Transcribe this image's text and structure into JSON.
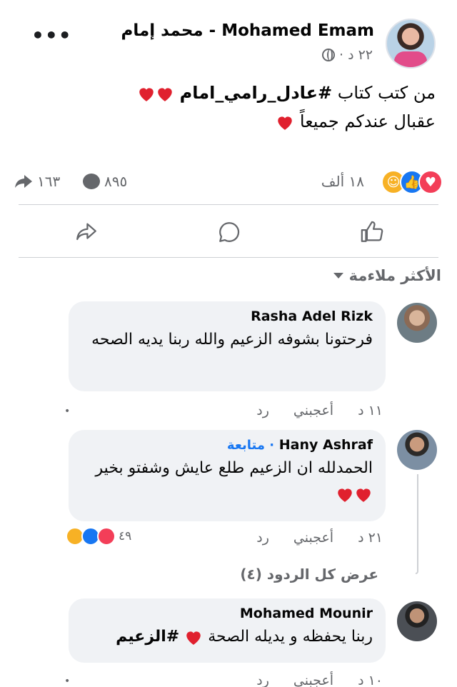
{
  "post": {
    "author": "Mohamed Emam - محمد إمام",
    "time": "٢٢ د ·",
    "line1_prefix": "من كتب كتاب",
    "line1_hashtag": "#عادل_رامي_امام",
    "line2": "عقبال عندكم جميعاً",
    "reactions_count": "١٨ ألف",
    "comments_count": "٨٩٥",
    "shares_count": "١٦٣"
  },
  "sort": {
    "label": "الأكثر ملاءمة"
  },
  "comments": [
    {
      "name": "Rasha Adel Rizk",
      "text": "فرحتونا بشوفه الزعيم والله ربنا يديه الصحه",
      "time": "١١ د",
      "like": "أعجبني",
      "reply": "رد",
      "dot": "•"
    },
    {
      "name": "Hany Ashraf",
      "follow": "· متابعة",
      "text": "الحمدلله ان الزعيم طلع عايش وشفتو بخير",
      "time": "٢١ د",
      "like": "أعجبني",
      "reply": "رد",
      "reactions_count": "٤٩",
      "view_replies": "عرض كل الردود (٤)"
    },
    {
      "name": "Mohamed Mounir",
      "text_prefix": "ربنا يحفظه و يديله الصحة",
      "text_hashtag": "#الزعيم",
      "time": "١٠ د",
      "like": "أعجبني",
      "reply": "رد",
      "dot": "•"
    }
  ],
  "icons": {
    "heart_color": "#f02849",
    "like_color": "#1877f2",
    "care_color": "#f7b125",
    "muted_color": "#65676b"
  }
}
